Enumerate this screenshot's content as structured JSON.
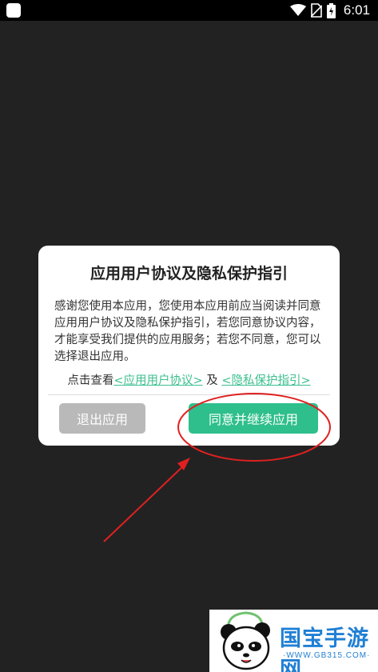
{
  "status_bar": {
    "time": "6:01",
    "icons": [
      "app-icon",
      "wifi-icon",
      "no-sim-icon",
      "battery-icon"
    ]
  },
  "dialog": {
    "title": "应用用户协议及隐私保护指引",
    "body": "感谢您使用本应用，您使用本应用前应当阅读并同意应用用户协议及隐私保护指引，若您同意协议内容，才能享受我们提供的应用服务；若您不同意，您可以选择退出应用。",
    "links_prefix": "点击查看",
    "user_agreement_link": "<应用用户协议>",
    "links_joiner": "及",
    "privacy_link": "<隐私保护指引>",
    "exit_button": "退出应用",
    "agree_button": "同意并继续应用"
  },
  "colors": {
    "accent": "#2ebf8c",
    "link": "#3bbf8f",
    "exit_button": "#b9b9b9",
    "annotation": "#e02020",
    "watermark": "#1f7fd4"
  },
  "watermark": {
    "brand": "国宝手游网",
    "url": "·WWW.GB315.COM·"
  }
}
